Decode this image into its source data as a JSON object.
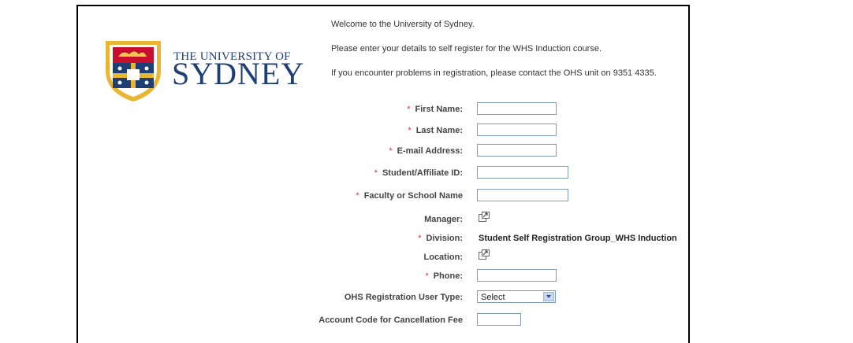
{
  "university": {
    "line1": "THE UNIVERSITY OF",
    "line2": "SYDNEY"
  },
  "intro": [
    "Welcome to the University of Sydney.",
    "Please enter your details to self register for the WHS Induction course.",
    "If you encounter problems in registration, please contact the OHS unit on 9351 4335."
  ],
  "form": {
    "required_mark": "*",
    "first_name": {
      "label": "First Name:",
      "value": ""
    },
    "last_name": {
      "label": "Last Name:",
      "value": ""
    },
    "email": {
      "label": "E-mail Address:",
      "value": ""
    },
    "student_id": {
      "label": "Student/Affiliate ID:",
      "value": ""
    },
    "faculty": {
      "label": "Faculty or School Name",
      "value": ""
    },
    "manager": {
      "label": "Manager:"
    },
    "division": {
      "label": "Division:",
      "value": "Student Self Registration Group_WHS Induction"
    },
    "location": {
      "label": "Location:"
    },
    "phone": {
      "label": "Phone:",
      "value": ""
    },
    "user_type": {
      "label": "OHS Registration User Type:",
      "selected": "Select"
    },
    "account_code": {
      "label": "Account Code for Cancellation Fee",
      "value": ""
    }
  },
  "colors": {
    "brand_blue": "#1d3f73",
    "required_red": "#dd3333",
    "crest_gold": "#e8b632",
    "crest_red": "#c8102e"
  }
}
